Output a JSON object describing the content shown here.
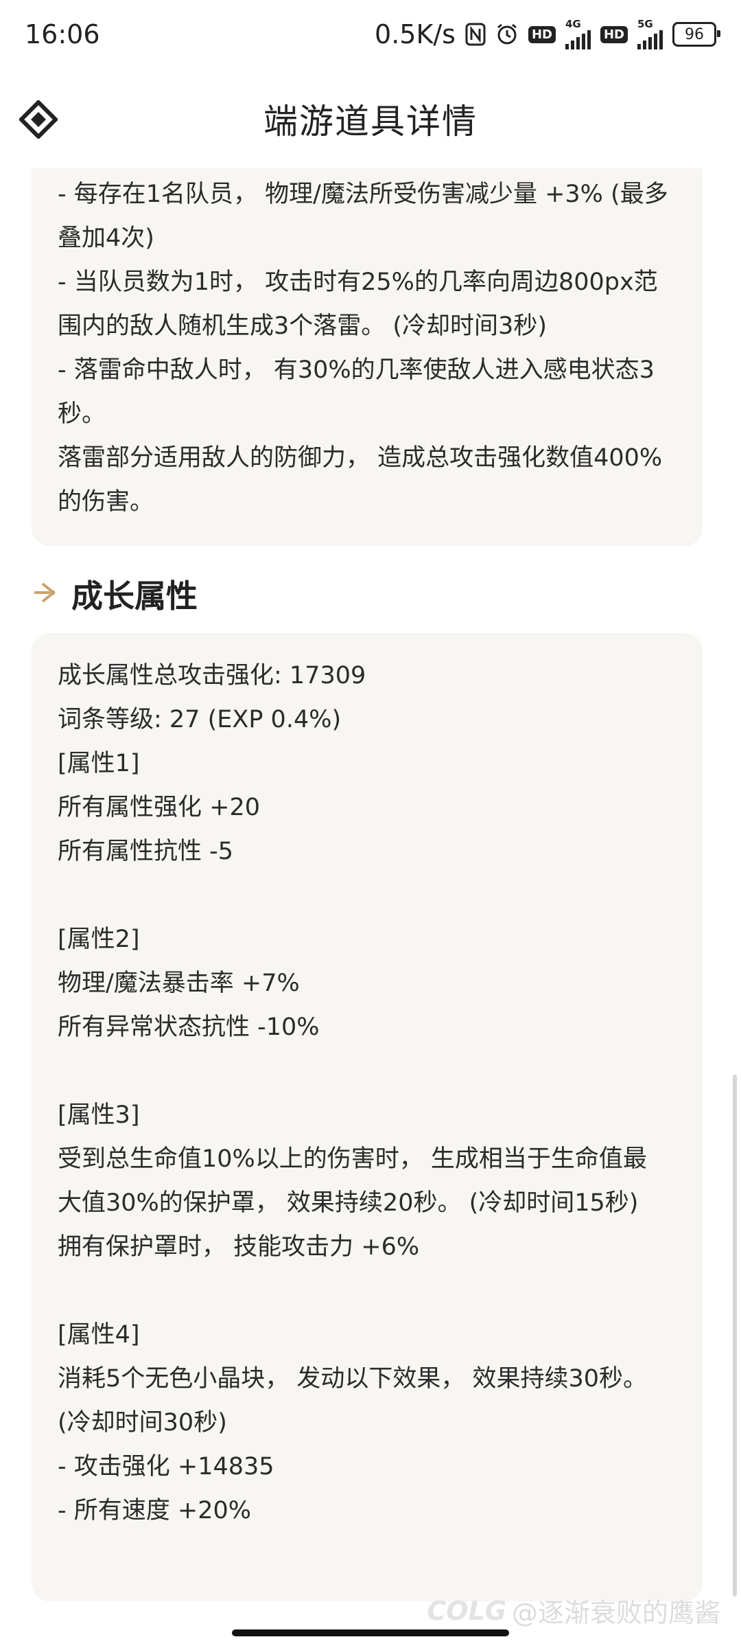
{
  "status_bar": {
    "time": "16:06",
    "net_speed": "0.5K/s",
    "sim1_label": "4G",
    "sim2_label": "5G",
    "hd_label": "HD",
    "battery": "96"
  },
  "header": {
    "title": "端游道具详情"
  },
  "effect_card": {
    "lines": [
      "- 每存在1名队员， 物理/魔法所受伤害减少量 +3% (最多",
      "叠加4次)",
      "- 当队员数为1时， 攻击时有25%的几率向周边800px范",
      "围内的敌人随机生成3个落雷。 (冷却时间3秒)",
      "- 落雷命中敌人时， 有30%的几率使敌人进入感电状态3",
      "秒。",
      "落雷部分适用敌人的防御力， 造成总攻击强化数值400%",
      "的伤害。"
    ]
  },
  "growth_section": {
    "title": "成长属性",
    "lines": [
      "成长属性总攻击强化: 17309",
      "词条等级: 27 (EXP 0.4%)",
      "[属性1]",
      "所有属性强化 +20",
      "所有属性抗性 -5",
      "",
      "[属性2]",
      "物理/魔法暴击率 +7%",
      "所有异常状态抗性 -10%",
      "",
      "[属性3]",
      "受到总生命值10%以上的伤害时， 生成相当于生命值最",
      "大值30%的保护罩， 效果持续20秒。 (冷却时间15秒)",
      "拥有保护罩时， 技能攻击力 +6%",
      "",
      "[属性4]",
      "消耗5个无色小晶块， 发动以下效果， 效果持续30秒。",
      "(冷却时间30秒)",
      "- 攻击强化 +14835",
      "- 所有速度 +20%"
    ]
  },
  "watermark": {
    "brand": "COLG",
    "user": "@逐渐衰败的鹰酱"
  },
  "colors": {
    "card_bg": "#f8f6f2",
    "accent_gold": "#c9a46a"
  },
  "icons": {
    "header_logo": "diamond-logo-icon",
    "section_marker": "arrow-right-icon"
  }
}
